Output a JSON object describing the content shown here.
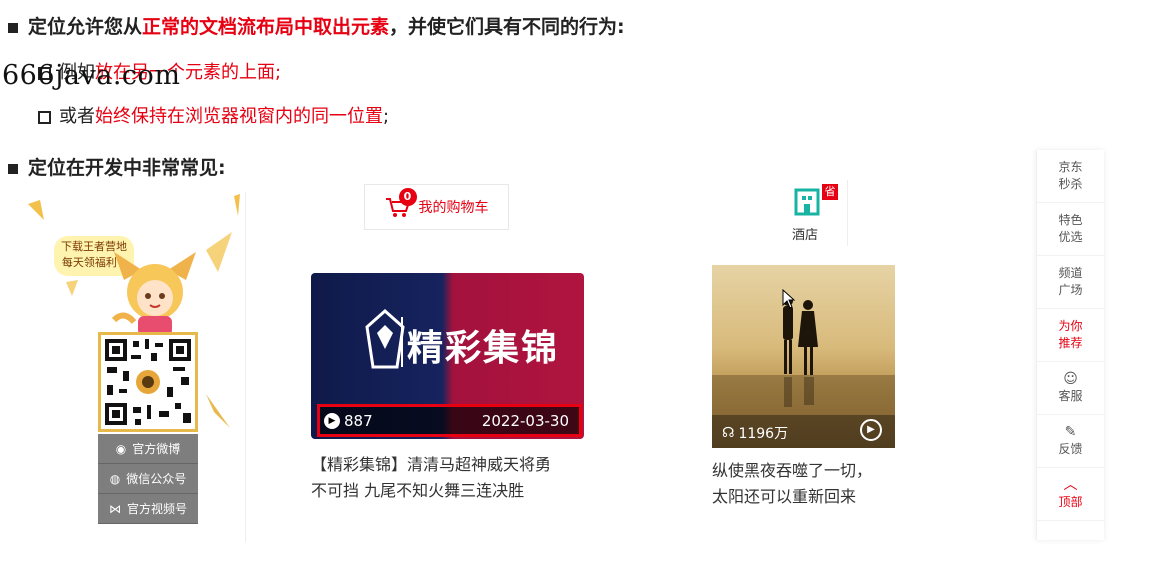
{
  "slide": {
    "line1": {
      "pre": "定位允许您从",
      "red": "正常的文档流布局中取出元素",
      "post": "，并使它们具有不同的行为:"
    },
    "line2": {
      "pre": "例如",
      "red": "放在另一个元素的上面;"
    },
    "line3": {
      "pre": "或者",
      "red": "始终保持在浏览器视窗内的同一位置",
      "post": ";"
    },
    "line4": "定位在开发中非常常见:"
  },
  "watermark": "666java.com",
  "left_panel": {
    "bubble": [
      "下载王者营地",
      "每天领福利~"
    ],
    "buttons": [
      {
        "label": "官方微博",
        "icon": "weibo-icon"
      },
      {
        "label": "微信公众号",
        "icon": "wechat-icon"
      },
      {
        "label": "官方视频号",
        "icon": "video-channel-icon"
      }
    ]
  },
  "cart": {
    "count": "0",
    "label": "我的购物车"
  },
  "hotel": {
    "badge": "省",
    "label": "酒店"
  },
  "video_card": {
    "title": "精彩集锦",
    "views": "887",
    "date": "2022-03-30",
    "caption": [
      "【精彩集锦】清清马超神威天将勇",
      "不可挡 九尾不知火舞三连决胜"
    ]
  },
  "photo_card": {
    "plays": "1196万",
    "caption": [
      "纵使黑夜吞噬了一切，",
      "太阳还可以重新回来"
    ]
  },
  "right_sidebar": [
    {
      "lines": [
        "京东",
        "秒杀"
      ],
      "active": false,
      "icon": ""
    },
    {
      "lines": [
        "特色",
        "优选"
      ],
      "active": false,
      "icon": ""
    },
    {
      "lines": [
        "频道",
        "广场"
      ],
      "active": false,
      "icon": ""
    },
    {
      "lines": [
        "为你",
        "推荐"
      ],
      "active": true,
      "icon": ""
    },
    {
      "lines": [
        "客服"
      ],
      "active": false,
      "icon": "smile-icon"
    },
    {
      "lines": [
        "反馈"
      ],
      "active": false,
      "icon": "pencil-icon"
    },
    {
      "lines": [
        "顶部"
      ],
      "active": true,
      "icon": "chevron-up-icon"
    }
  ],
  "colors": {
    "accent": "#e60012",
    "text": "#222222",
    "qr_border": "#e7b94a"
  }
}
